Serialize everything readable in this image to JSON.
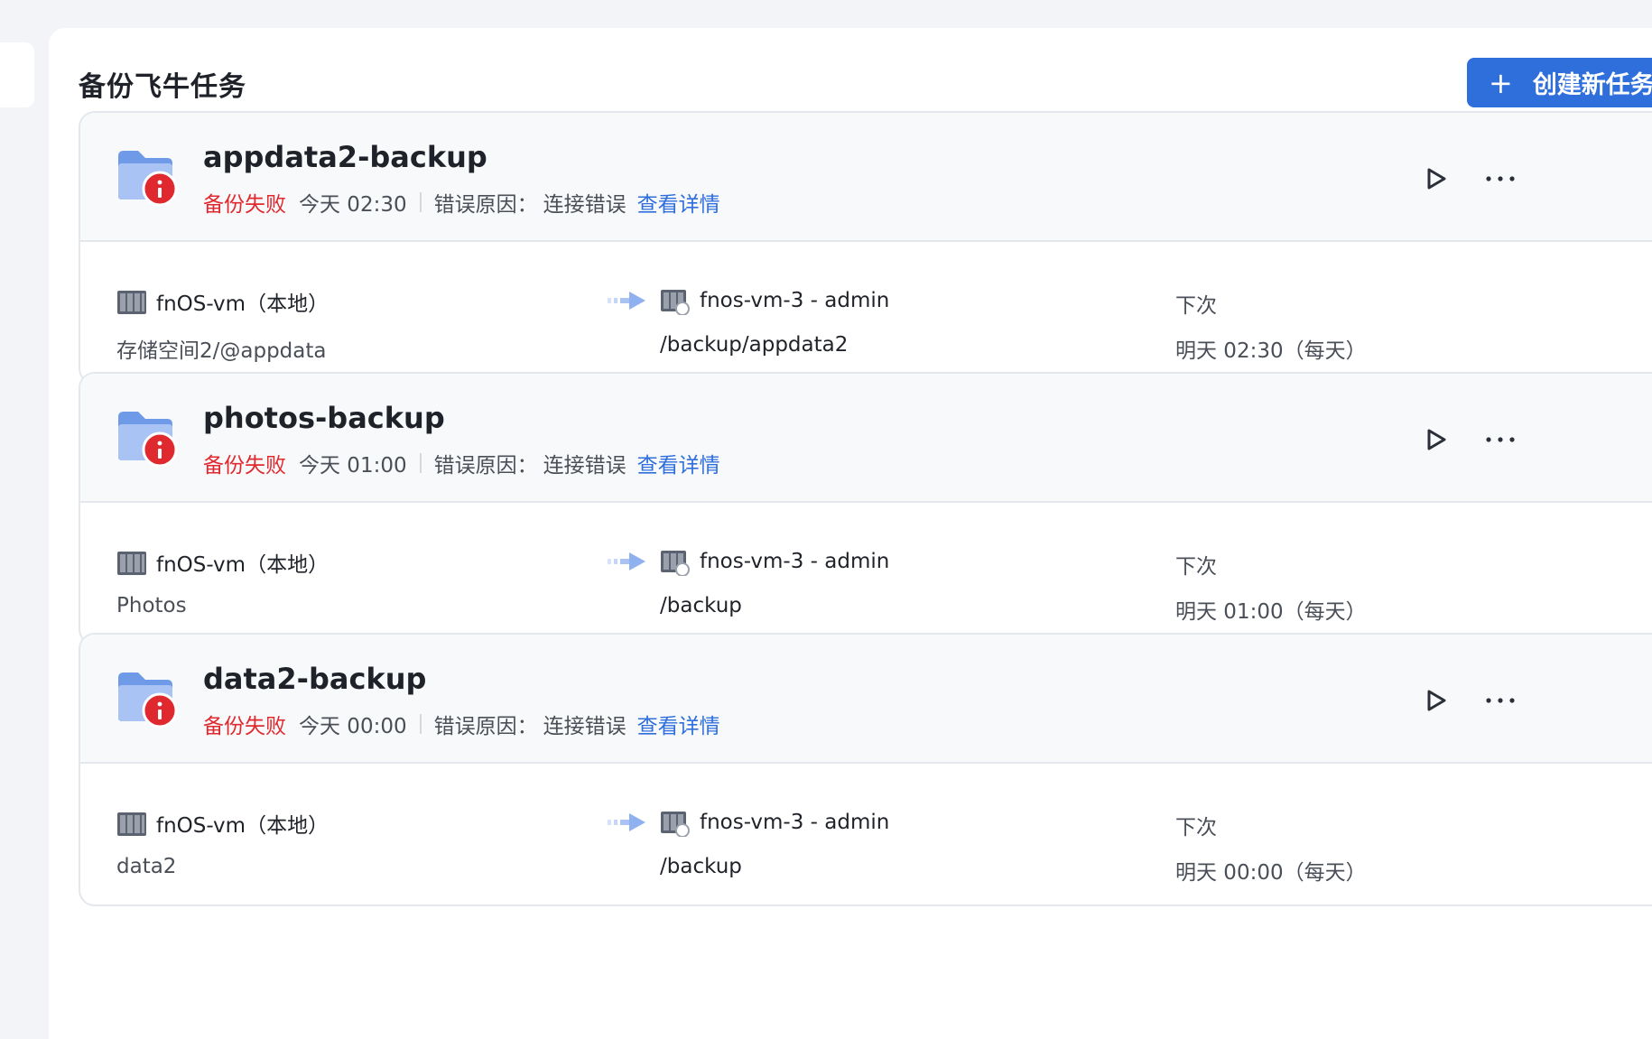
{
  "page": {
    "title": "备份飞牛任务",
    "create_button": "创建新任务"
  },
  "colors": {
    "accent": "#2f6fdc",
    "error": "#e0292e"
  },
  "tasks": [
    {
      "name": "appdata2-backup",
      "status": "备份失败",
      "time": "今天 02:30",
      "error_label": "错误原因：",
      "error_reason": "连接错误",
      "detail_link": "查看详情",
      "source_host": "fnOS-vm（本地）",
      "source_path": "存储空间2/@appdata",
      "target_host": "fnos-vm-3 - admin",
      "target_path": "/backup/appdata2",
      "next_label": "下次",
      "next_time": "明天 02:30（每天）"
    },
    {
      "name": "photos-backup",
      "status": "备份失败",
      "time": "今天 01:00",
      "error_label": "错误原因：",
      "error_reason": "连接错误",
      "detail_link": "查看详情",
      "source_host": "fnOS-vm（本地）",
      "source_path": "Photos",
      "target_host": "fnos-vm-3 - admin",
      "target_path": "/backup",
      "next_label": "下次",
      "next_time": "明天 01:00（每天）"
    },
    {
      "name": "data2-backup",
      "status": "备份失败",
      "time": "今天 00:00",
      "error_label": "错误原因：",
      "error_reason": "连接错误",
      "detail_link": "查看详情",
      "source_host": "fnOS-vm（本地）",
      "source_path": "data2",
      "target_host": "fnos-vm-3 - admin",
      "target_path": "/backup",
      "next_label": "下次",
      "next_time": "明天 00:00（每天）"
    }
  ]
}
